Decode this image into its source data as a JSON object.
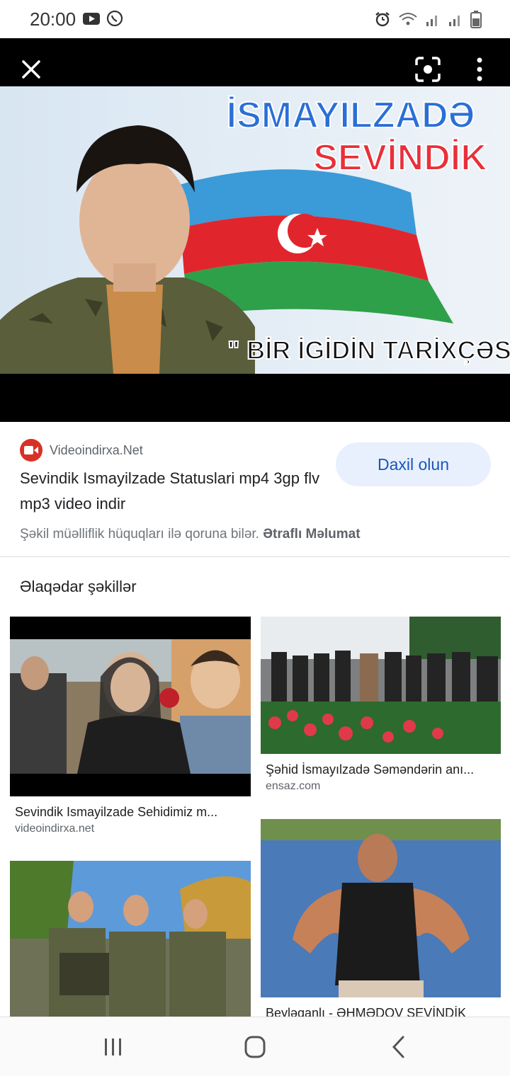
{
  "status_bar": {
    "time": "20:00",
    "left_icons": [
      "youtube-icon",
      "whatsapp-icon"
    ],
    "right_icons": [
      "alarm-icon",
      "wifi-icon",
      "signal-icon",
      "signal-icon",
      "battery-icon"
    ]
  },
  "viewer": {
    "close_icon": "close-icon",
    "lens_icon": "lens-icon",
    "more_icon": "more-vert-icon",
    "hero_image": {
      "line1": "İSMAYILZADƏ",
      "line2": "SEVİNDİK",
      "tagline": "\" BİR İGİDİN TARİXÇƏSİ\""
    }
  },
  "result": {
    "source_name": "Videoindirxa.Net",
    "title": "Sevindik Ismayilzade Statuslari mp4 3gp flv mp3 video indir",
    "visit_button": "Daxil olun",
    "copyright_text": "Şəkil müəlliflik hüquqları ilə qoruna bilər.",
    "copyright_link": "Ətraflı Məlumat"
  },
  "related": {
    "heading": "Əlaqədar şəkillər",
    "items": [
      {
        "title": "Sevindik Ismayilzade Sehidimiz m...",
        "source": "videoindirxa.net"
      },
      {
        "title": "Şəhid İsmayılzadə Səməndərin anı...",
        "source": "ensaz.com"
      },
      {
        "title": "",
        "source": ""
      },
      {
        "title": "Beyləqanlı - ƏHMƏDOV SEVİNDİK",
        "source": ""
      }
    ]
  },
  "colors": {
    "accent": "#1a56b8",
    "button_bg": "#e8f0fe",
    "source_icon": "#d93025"
  }
}
